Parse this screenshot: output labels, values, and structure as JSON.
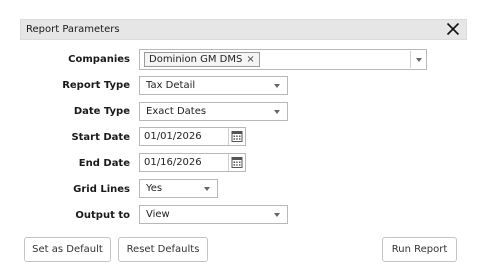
{
  "dialog": {
    "title": "Report Parameters",
    "close_icon": "close-icon"
  },
  "fields": {
    "companies": {
      "label": "Companies",
      "chip": "Dominion GM DMS",
      "chip_remove": "×"
    },
    "report_type": {
      "label": "Report Type",
      "value": "Tax Detail"
    },
    "date_type": {
      "label": "Date Type",
      "value": "Exact Dates"
    },
    "start_date": {
      "label": "Start Date",
      "value": "01/01/2026",
      "icon": "calendar-icon"
    },
    "end_date": {
      "label": "End Date",
      "value": "01/16/2026",
      "icon": "calendar-icon"
    },
    "grid_lines": {
      "label": "Grid Lines",
      "value": "Yes"
    },
    "output_to": {
      "label": "Output to",
      "value": "View"
    }
  },
  "buttons": {
    "set_default": "Set as Default",
    "reset_defaults": "Reset Defaults",
    "run_report": "Run Report"
  }
}
